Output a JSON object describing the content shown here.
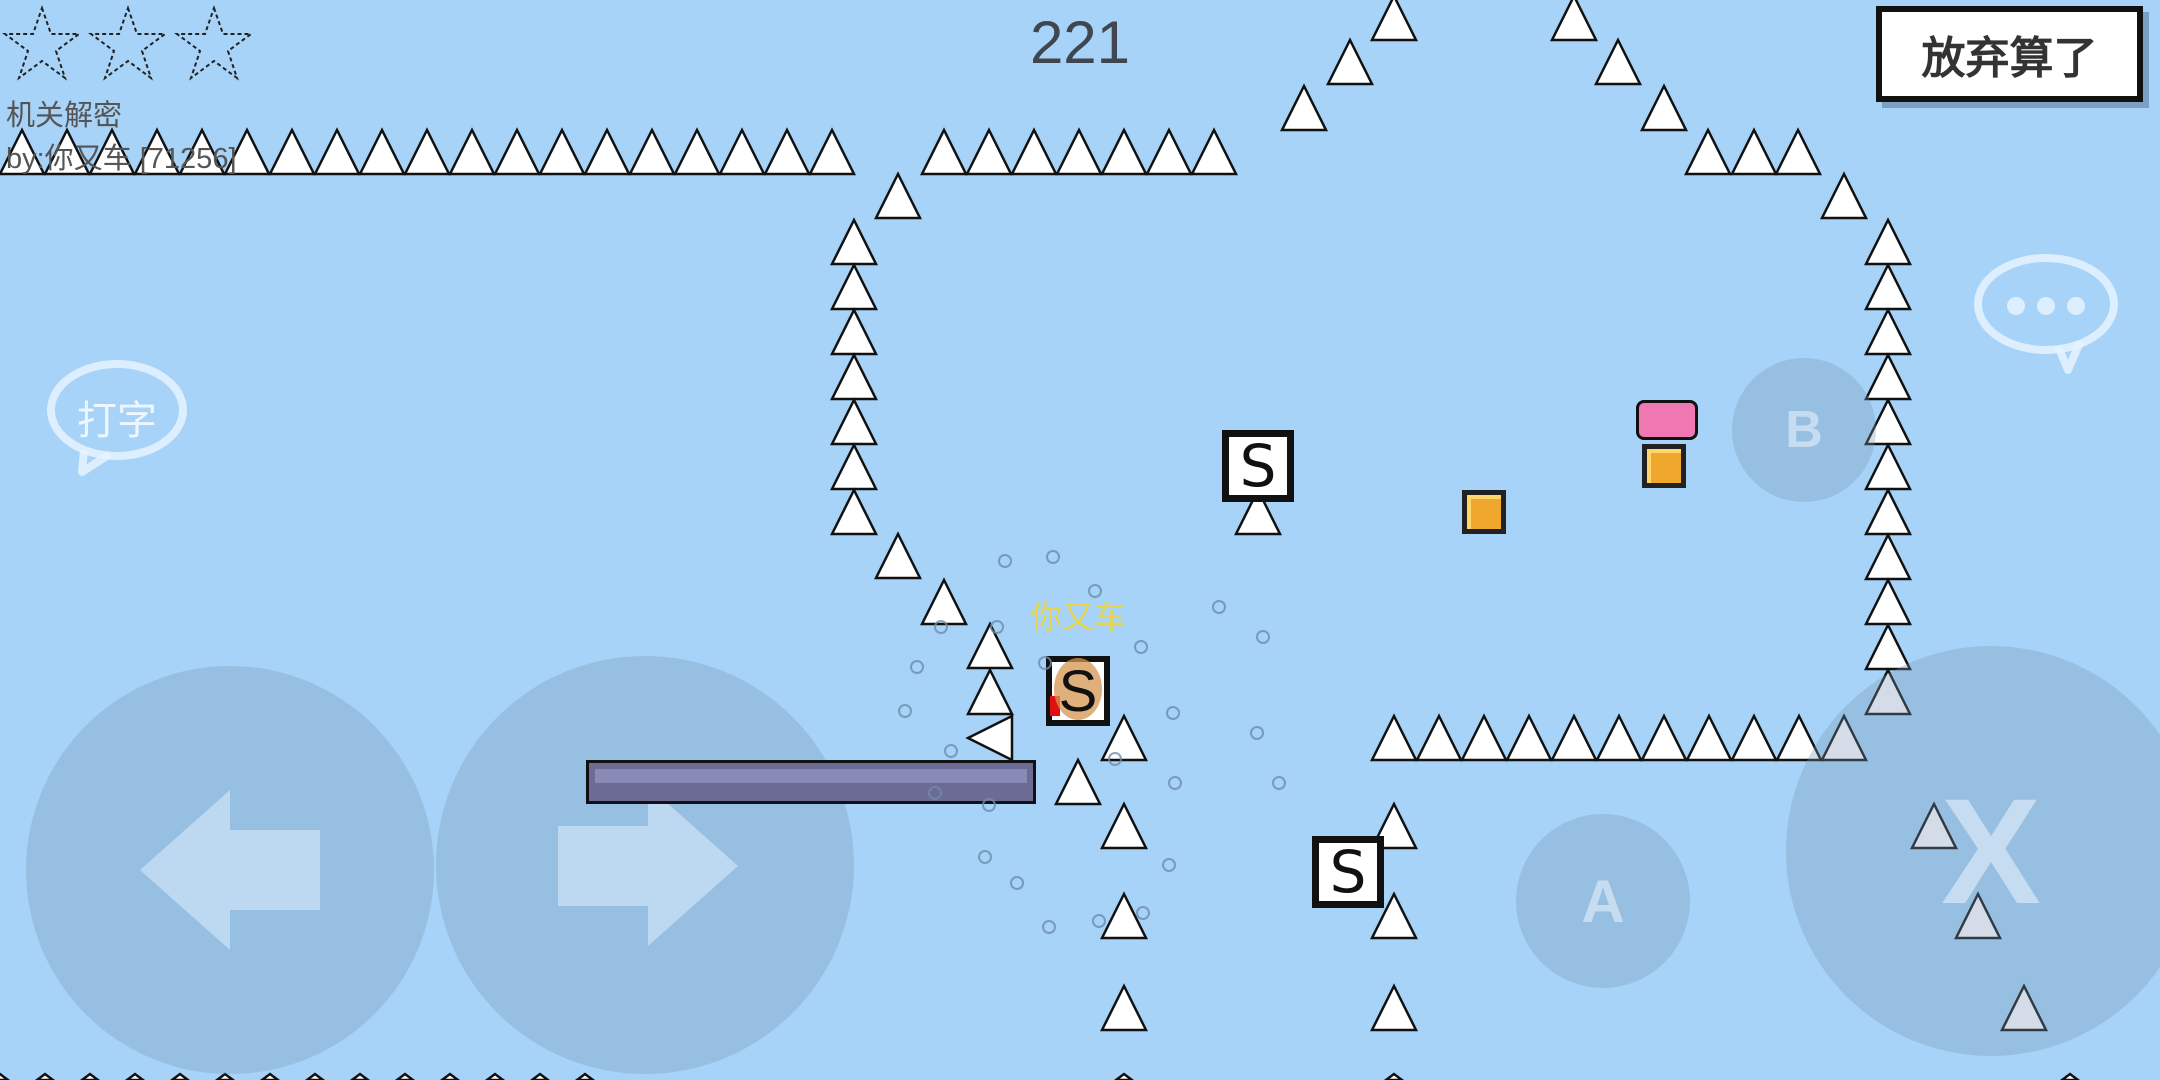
{
  "hud": {
    "timer": "221",
    "give_up_label": "放弃算了",
    "level_title": "机关解密",
    "level_author": "by:你又车 [71256]",
    "stars": [
      "empty",
      "empty",
      "empty"
    ]
  },
  "controls": {
    "type_label": "打字",
    "chat_icon": "chat-bubble-icon",
    "b_label": "B",
    "a_label": "A",
    "x_label": "X",
    "left_icon": "arrow-left-icon",
    "right_icon": "arrow-right-icon"
  },
  "player": {
    "name": "你又车"
  },
  "save_points": [
    {
      "label": "S"
    },
    {
      "label": "S"
    },
    {
      "label": "S"
    }
  ],
  "colors": {
    "sky": "#a6d3f7",
    "spike": "#ffffff",
    "platform": "#6b6b96",
    "coin": "#f0a72e",
    "pink_block": "#ef78b3",
    "player_name": "#e9d44b"
  }
}
